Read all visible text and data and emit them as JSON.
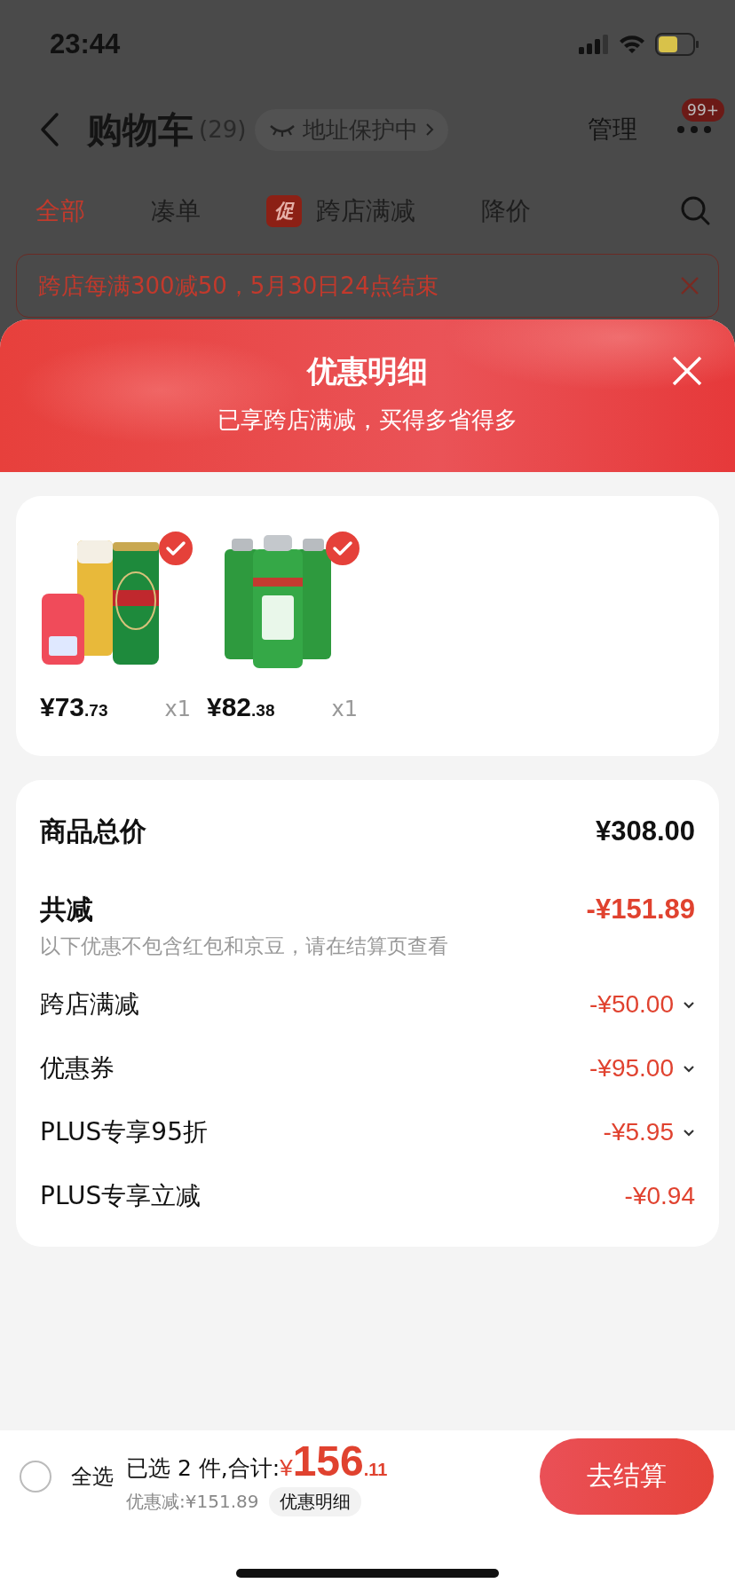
{
  "status_bar": {
    "time": "23:44"
  },
  "nav": {
    "title": "购物车",
    "count": "(29)",
    "address_chip": "地址保护中",
    "manage": "管理",
    "badge": "99+"
  },
  "tabs": [
    {
      "label": "全部",
      "selected": true
    },
    {
      "label": "凑单",
      "selected": false
    },
    {
      "label": "跨店满减",
      "selected": false,
      "tag": "促"
    },
    {
      "label": "降价",
      "selected": false
    }
  ],
  "promo_banner": {
    "text": "跨店每满300减50，5月30日24点结束"
  },
  "sheet": {
    "title": "优惠明细",
    "subtitle": "已享跨店满减，买得多省得多",
    "products": [
      {
        "kind": "picture",
        "price_main": "¥73",
        "price_cents": ".73",
        "qty": "x1",
        "checked": true
      },
      {
        "kind": "picture",
        "price_main": "¥82",
        "price_cents": ".38",
        "qty": "x1",
        "checked": true
      }
    ],
    "summary": [
      {
        "kind": "total",
        "label": "商品总价",
        "amount": "¥308.00"
      },
      {
        "kind": "discount_total",
        "label": "共减",
        "amount": "-¥151.89",
        "note": "以下优惠不包含红包和京豆，请在结算页查看"
      },
      {
        "kind": "item",
        "label": "跨店满减",
        "amount": "-¥50.00",
        "expandable": true
      },
      {
        "kind": "item",
        "label": "优惠券",
        "amount": "-¥95.00",
        "expandable": true
      },
      {
        "kind": "item",
        "label": "PLUS专享95折",
        "amount": "-¥5.95",
        "expandable": true
      },
      {
        "kind": "item",
        "label": "PLUS专享立减",
        "amount": "-¥0.94",
        "expandable": false
      }
    ]
  },
  "bottom_bar": {
    "select_all": {
      "label": "全选",
      "checked": false
    },
    "summary": "已选 2 件,合计:",
    "currency": "¥",
    "total_main": "156",
    "total_cents": ".11",
    "saved": "优惠减:¥151.89",
    "details_button": "优惠明细",
    "checkout": "去结算"
  }
}
